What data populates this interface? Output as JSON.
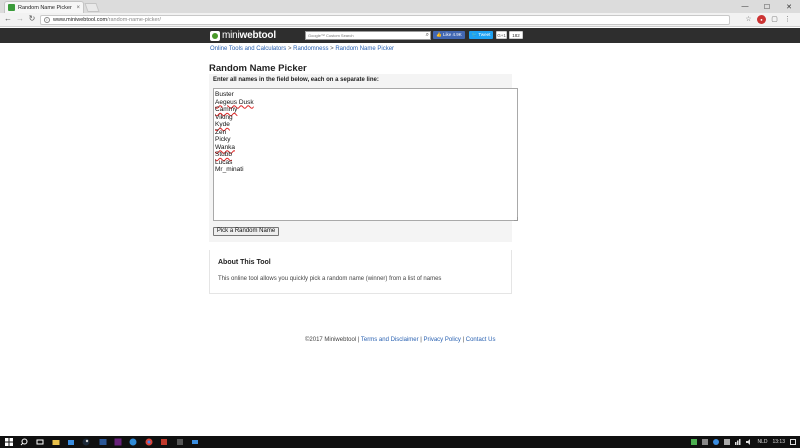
{
  "browser": {
    "tab_title": "Random Name Picker - C",
    "tab_close": "×",
    "url_host": "www.miniwebtool.com",
    "url_path": "/random-name-picker/",
    "window_controls": [
      "—",
      "☐",
      "✕"
    ]
  },
  "site": {
    "logo_mini": "mini",
    "logo_webtool": "webtool",
    "search_placeholder": "Google™ Custom Search",
    "fb_label": "👍 Like 4.9K",
    "tweet_label": "🐦 Tweet",
    "gplus_label": "G+1",
    "gplus_count": "182"
  },
  "breadcrumb": {
    "items": [
      "Online Tools and Calculators",
      "Randomness",
      "Random Name Picker"
    ],
    "separator": ">"
  },
  "main": {
    "title": "Random Name Picker",
    "instructions": "Enter all names in the field below, each on a separate line:",
    "names": [
      "Buster",
      "Aegeus Dusk",
      "Cammy",
      "Viking",
      "Kyde",
      "Zen",
      "Picky",
      "Wanka",
      "Stubb",
      "Lucas",
      "Mr_minati"
    ],
    "pick_button": "Pick a Random Name"
  },
  "about": {
    "title": "About This Tool",
    "text": "This online tool allows you quickly pick a random name (winner) from a list of names"
  },
  "footer": {
    "copyright": "©2017 Miniwebtool",
    "links": [
      "Terms and Disclaimer",
      "Privacy Policy",
      "Contact Us"
    ],
    "separator": "|"
  },
  "taskbar": {
    "language": "NLD",
    "time": "13:13"
  },
  "colors": {
    "header_bg": "#2e2e2e",
    "link": "#2a62b2",
    "logo_green": "#4a9a2a",
    "facebook": "#4267b2",
    "twitter": "#1da1f2"
  }
}
